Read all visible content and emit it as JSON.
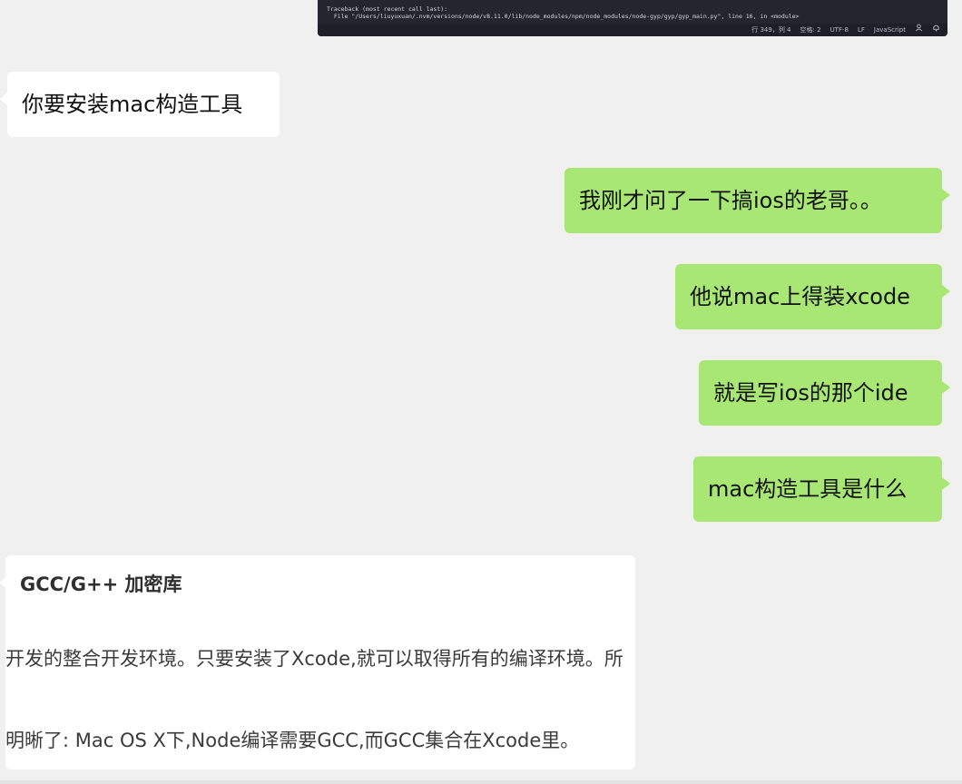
{
  "editor": {
    "code_line1": "Traceback (most recent call last):",
    "code_line2": "  File \"/Users/liuyuxuan/.nvm/versions/node/v8.11.0/lib/node_modules/npm/node_modules/node-gyp/gyp/gyp_main.py\", line 16, in <module>",
    "status": {
      "position": "行 349，列 4",
      "spaces": "空格: 2",
      "encoding": "UTF-8",
      "eol": "LF",
      "language": "JavaScript",
      "icon1": "person-icon",
      "icon2": "bell-icon"
    }
  },
  "messages": [
    {
      "side": "left",
      "text": "你要安装mac构造工具"
    },
    {
      "side": "right",
      "text": "我刚才问了一下搞ios的老哥。。"
    },
    {
      "side": "right",
      "text": "他说mac上得装xcode"
    },
    {
      "side": "right",
      "text": "就是写ios的那个ide"
    },
    {
      "side": "right",
      "text": "mac构造工具是什么"
    }
  ],
  "card": {
    "title": "GCC/G++ 加密库",
    "line1": "开发的整合开发环境。只要安装了Xcode,就可以取得所有的编译环境。所",
    "line2": "明晰了: Mac OS X下,Node编译需要GCC,而GCC集合在Xcode里。"
  },
  "colors": {
    "background": "#f0f0f0",
    "outgoing_bubble": "#a9e774",
    "incoming_bubble": "#ffffff",
    "editor_bg": "#23262e"
  }
}
